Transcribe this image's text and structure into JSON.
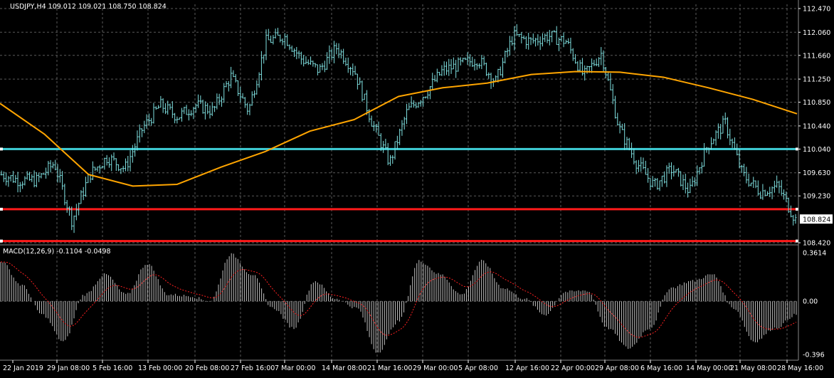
{
  "colors": {
    "background": "#000000",
    "bars": "#7fe0e0",
    "ma": "#ffa500",
    "cyan_line": "#40d0d8",
    "red_line": "#ff1a1a",
    "macd_hist": "#c0c0c0",
    "macd_signal": "#ff2020",
    "grid": "#5a5a5a",
    "axis_text": "#ffffff",
    "price_tag_bg": "#ffffff",
    "price_tag_text": "#000000"
  },
  "header": {
    "symbol_line": "USDJPY,H4  109.012 109.021 108.750 108.824",
    "indicator_line": "MACD(12,26,9) -0.1104 -0.0498"
  },
  "price_axis": {
    "ticks": [
      "112.470",
      "112.060",
      "111.660",
      "111.250",
      "110.850",
      "110.440",
      "110.040",
      "109.630",
      "109.230",
      "108.824",
      "108.420"
    ],
    "current_price": "108.824"
  },
  "macd_axis": {
    "ticks": [
      "0.3614",
      "0.00",
      "-0.396"
    ]
  },
  "time_axis": {
    "ticks": [
      "22 Jan 2019",
      "29 Jan 08:00",
      "5 Feb 16:00",
      "13 Feb 00:00",
      "20 Feb 08:00",
      "27 Feb 16:00",
      "7 Mar 00:00",
      "14 Mar 08:00",
      "21 Mar 16:00",
      "29 Mar 00:00",
      "5 Apr 08:00",
      "12 Apr 16:00",
      "22 Apr 00:00",
      "29 Apr 08:00",
      "6 May 16:00",
      "14 May 00:00",
      "21 May 08:00",
      "28 May 16:00"
    ]
  },
  "chart_data": {
    "type": "line",
    "title": "USDJPY,H4",
    "symbol": "USDJPY",
    "timeframe": "H4",
    "last_bar": {
      "open": 109.012,
      "high": 109.021,
      "low": 108.75,
      "close": 108.824
    },
    "ylim": [
      108.42,
      112.47
    ],
    "x": [
      "22 Jan 2019",
      "29 Jan 08:00",
      "5 Feb 16:00",
      "13 Feb 00:00",
      "20 Feb 08:00",
      "27 Feb 16:00",
      "7 Mar 00:00",
      "14 Mar 08:00",
      "21 Mar 16:00",
      "29 Mar 00:00",
      "5 Apr 08:00",
      "12 Apr 16:00",
      "22 Apr 00:00",
      "29 Apr 08:00",
      "6 May 16:00",
      "14 May 00:00",
      "21 May 08:00",
      "28 May 16:00"
    ],
    "price_series": [
      109.6,
      109.5,
      109.5,
      109.8,
      108.8,
      109.6,
      109.9,
      109.7,
      110.4,
      110.8,
      110.6,
      110.8,
      110.7,
      111.3,
      110.7,
      111.9,
      112.0,
      111.6,
      111.4,
      111.8,
      111.4,
      110.5,
      109.8,
      110.7,
      111.0,
      111.4,
      111.5,
      111.6,
      111.2,
      112.0,
      111.9,
      112.0,
      111.9,
      111.3,
      111.7,
      110.4,
      109.8,
      109.4,
      109.7,
      109.3,
      110.1,
      110.5,
      109.6,
      109.3,
      109.4,
      108.82
    ],
    "moving_average": [
      110.83,
      110.3,
      109.6,
      109.4,
      109.43,
      109.73,
      110.0,
      110.35,
      110.55,
      110.95,
      111.1,
      111.18,
      111.33,
      111.38,
      111.37,
      111.28,
      111.1,
      110.9,
      110.65
    ],
    "horizontal_lines": [
      {
        "name": "cyan level",
        "value": 110.04
      },
      {
        "name": "red level 1",
        "value": 109.0
      },
      {
        "name": "red level 2",
        "value": 108.45
      }
    ],
    "macd": {
      "label": "MACD(12,26,9)",
      "main": -0.1104,
      "signal": -0.0498,
      "ylim": [
        -0.396,
        0.3614
      ],
      "hist_series": [
        0.3,
        0.12,
        -0.1,
        -0.3,
        0.05,
        0.2,
        0.05,
        0.28,
        0.05,
        0.04,
        0.0,
        0.35,
        0.2,
        -0.05,
        -0.2,
        0.15,
        0.02,
        -0.05,
        -0.38,
        -0.15,
        0.3,
        0.2,
        0.05,
        0.3,
        0.1,
        0.02,
        -0.1,
        0.07,
        0.08,
        -0.2,
        -0.35,
        -0.2,
        0.1,
        0.15,
        0.2,
        -0.05,
        -0.3,
        -0.2,
        -0.1
      ]
    }
  }
}
